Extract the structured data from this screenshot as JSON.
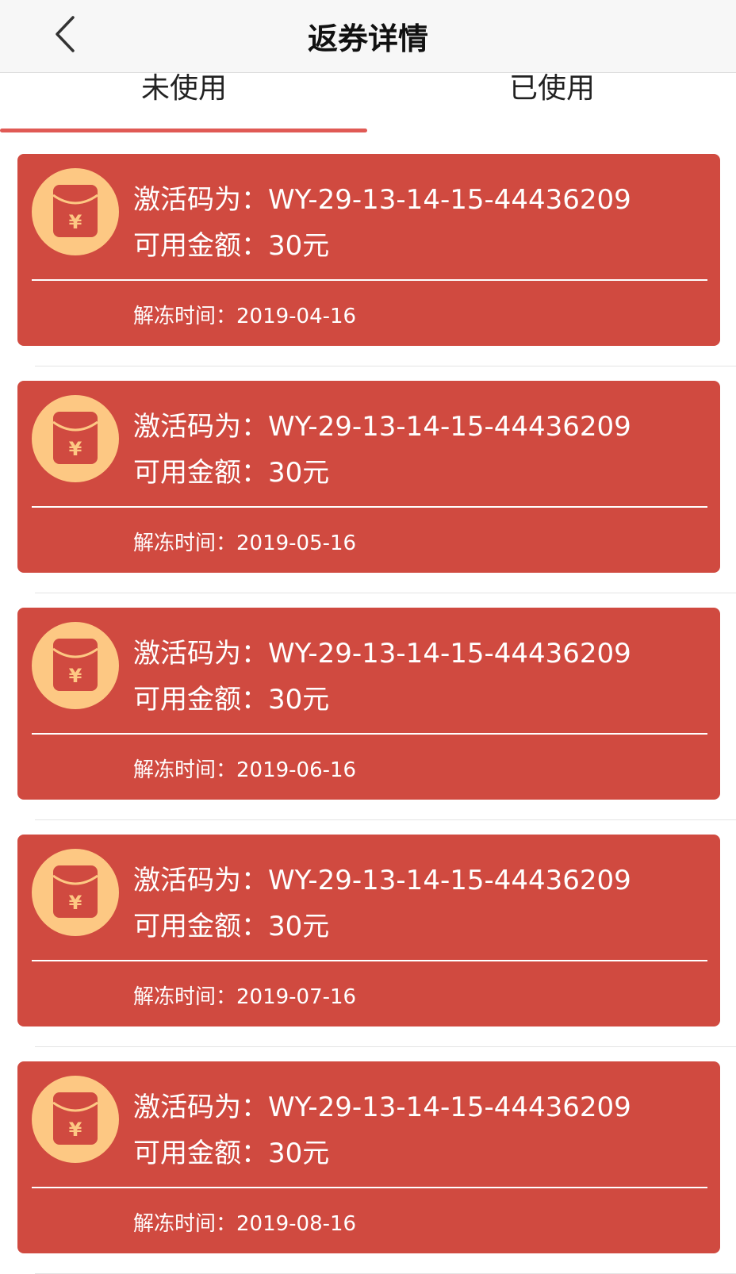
{
  "nav": {
    "title": "返券详情"
  },
  "tabs": [
    {
      "label": "未使用",
      "active": true
    },
    {
      "label": "已使用",
      "active": false
    }
  ],
  "colors": {
    "card": "#d04a40",
    "badge": "#fdc883",
    "indicator": "#e05a55"
  },
  "icons": {
    "back": "chevron-left-icon",
    "coupon": "red-envelope-yen-icon"
  },
  "coupons": [
    {
      "code": "激活码为：WY-29-13-14-15-44436209",
      "amount": "可用金额：30元",
      "unfreeze": "解冻时间：2019-04-16"
    },
    {
      "code": "激活码为：WY-29-13-14-15-44436209",
      "amount": "可用金额：30元",
      "unfreeze": "解冻时间：2019-05-16"
    },
    {
      "code": "激活码为：WY-29-13-14-15-44436209",
      "amount": "可用金额：30元",
      "unfreeze": "解冻时间：2019-06-16"
    },
    {
      "code": "激活码为：WY-29-13-14-15-44436209",
      "amount": "可用金额：30元",
      "unfreeze": "解冻时间：2019-07-16"
    },
    {
      "code": "激活码为：WY-29-13-14-15-44436209",
      "amount": "可用金额：30元",
      "unfreeze": "解冻时间：2019-08-16"
    }
  ]
}
